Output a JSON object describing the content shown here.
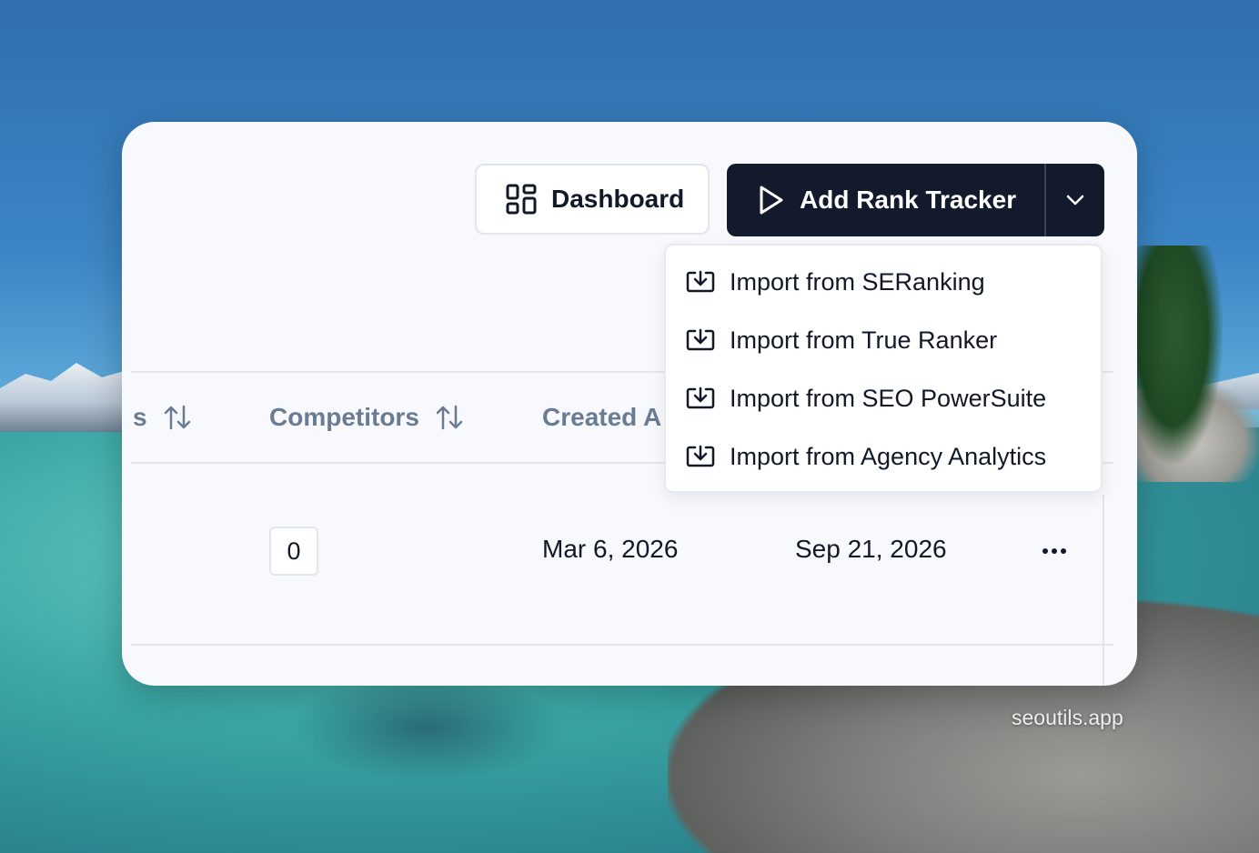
{
  "toolbar": {
    "dashboard_label": "Dashboard",
    "add_tracker_label": "Add Rank Tracker"
  },
  "dropdown": {
    "items": [
      {
        "label": "Import from SERanking"
      },
      {
        "label": "Import from True Ranker"
      },
      {
        "label": "Import from SEO PowerSuite"
      },
      {
        "label": "Import from Agency Analytics"
      }
    ]
  },
  "table": {
    "headers": {
      "partial": "s",
      "competitors": "Competitors",
      "created": "Created A"
    },
    "rows": [
      {
        "competitors": "0",
        "created": "Mar 6, 2026",
        "expires": "Sep 21, 2026"
      }
    ]
  },
  "watermark": "seoutils.app",
  "colors": {
    "primary_button": "#121a2c",
    "header_text": "#6b7b93",
    "card_bg": "#f7f9fc"
  },
  "icons": {
    "dashboard": "grid-layout-icon",
    "add": "play-icon",
    "caret": "chevron-down-icon",
    "import": "download-box-icon",
    "sort": "sort-arrows-icon",
    "more": "more-horizontal-icon"
  }
}
